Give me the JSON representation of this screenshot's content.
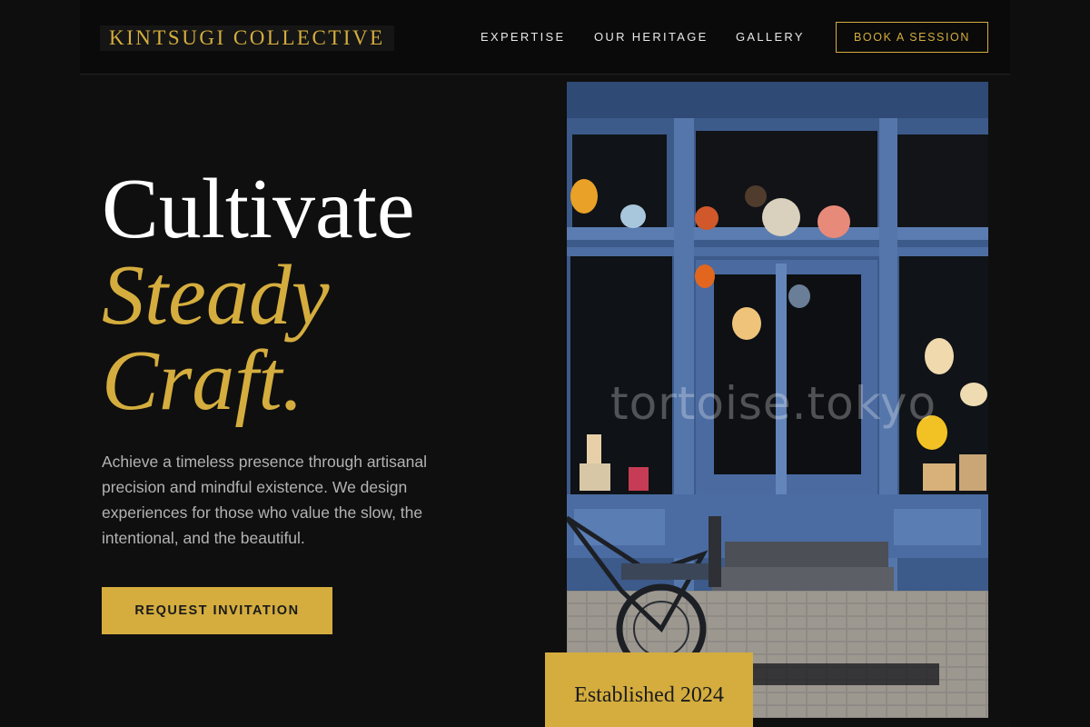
{
  "brand": {
    "name": "KINTSUGI COLLECTIVE",
    "accent": "#d4ad3e"
  },
  "nav": {
    "items": [
      {
        "label": "EXPERTISE"
      },
      {
        "label": "OUR HERITAGE"
      },
      {
        "label": "GALLERY"
      }
    ],
    "cta_label": "BOOK A SESSION"
  },
  "hero": {
    "line1": "Cultivate",
    "line2": "Steady",
    "line3": "Craft.",
    "description": "Achieve a timeless presence through artisanal precision and mindful existence. We design experiences for those who value the slow, the intentional, and the beautiful.",
    "cta_label": "REQUEST INVITATION"
  },
  "photo": {
    "watermark": "tortoise.tokyo",
    "badge": "Established 2024"
  }
}
